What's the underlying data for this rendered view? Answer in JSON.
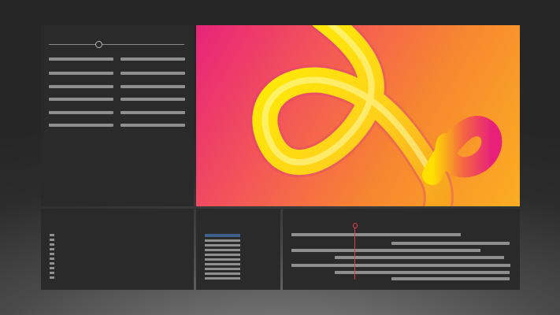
{
  "app": {
    "accent": "#3c5f8b",
    "playhead_color": "#e04040"
  },
  "properties_panel": {
    "slider_value": 0.37,
    "rows": 6,
    "columns": 2
  },
  "viewer": {
    "artwork": "3d-ribbon-loop",
    "gradient_colors": [
      "#e8237a",
      "#f45a55",
      "#f7882f",
      "#fbae22"
    ],
    "ribbon_colors": [
      "#fff200",
      "#ffc21a",
      "#f0207a"
    ]
  },
  "media_panel": {
    "items": 10
  },
  "effects_panel": {
    "selected_index": 0,
    "items": 10
  },
  "timeline": {
    "playhead_position": 0.3,
    "tracks": 6
  }
}
